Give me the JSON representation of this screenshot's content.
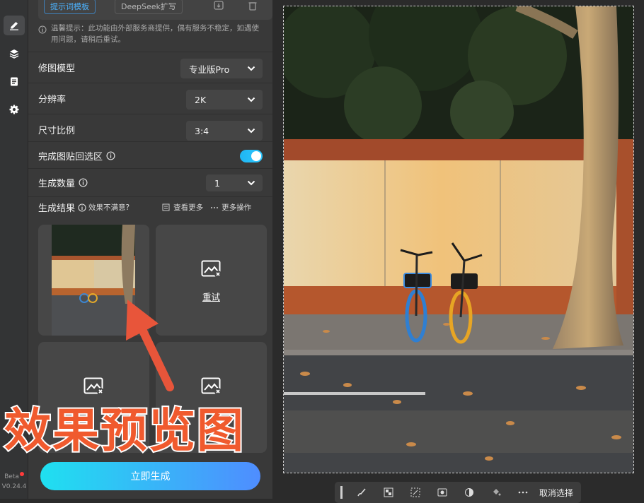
{
  "rail": {
    "items": [
      {
        "icon": "pen-edit-icon",
        "active": true
      },
      {
        "icon": "layers-icon",
        "active": false
      },
      {
        "icon": "clipboard-icon",
        "active": false
      },
      {
        "icon": "gear-icon",
        "active": false
      }
    ],
    "beta_label": "Beta",
    "version": "V0.24.4"
  },
  "top_buttons": {
    "prompt_template": "提示词模板",
    "deepseek": "DeepSeek扩写"
  },
  "tip": "温馨提示：此功能由外部服务商提供，偶有服务不稳定，如遇使用问题，请稍后重试。",
  "settings": {
    "model": {
      "label": "修图模型",
      "value": "专业版Pro"
    },
    "resolution": {
      "label": "分辨率",
      "value": "2K"
    },
    "aspect": {
      "label": "尺寸比例",
      "value": "3:4"
    },
    "paste_back": {
      "label": "完成图贴回选区",
      "enabled": true
    },
    "count": {
      "label": "生成数量",
      "value": "1"
    }
  },
  "results": {
    "title": "生成结果",
    "unsatisfied": "效果不满意?",
    "view_more": "查看更多",
    "more_actions": "更多操作",
    "retry_label": "重试"
  },
  "generate_button": "立即生成",
  "overlay_caption": "效果预览图",
  "toolbar": {
    "cancel_selection": "取消选择"
  },
  "colors": {
    "accent": "#2ec7ff",
    "caption": "#f05a2e",
    "button_start": "#1fe0f0",
    "button_end": "#4f8dff"
  }
}
